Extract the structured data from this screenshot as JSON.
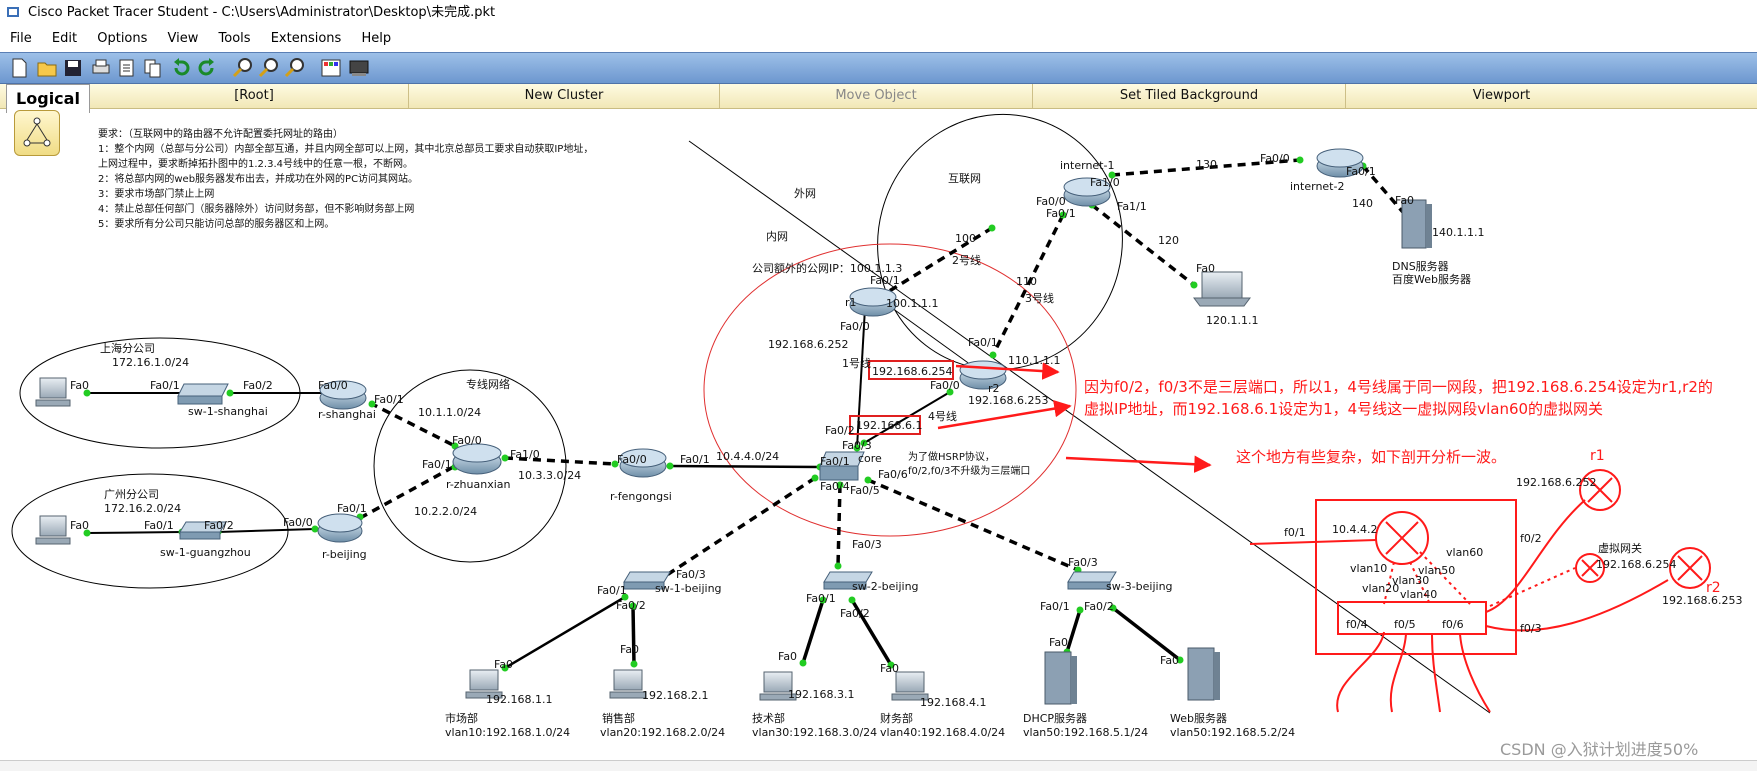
{
  "window": {
    "title": "Cisco Packet Tracer Student - C:\\Users\\Administrator\\Desktop\\未完成.pkt"
  },
  "menu": [
    "File",
    "Edit",
    "Options",
    "View",
    "Tools",
    "Extensions",
    "Help"
  ],
  "logical_bar": {
    "tab": "Logical",
    "root": "[Root]",
    "new_cluster": "New Cluster",
    "move_object": "Move Object",
    "set_background": "Set Tiled Background",
    "viewport": "Viewport"
  },
  "requirements": [
    "要求：（互联网中的路由器不允许配置委托网址的路由）",
    "1：整个内网（总部与分公司）内部全部互通，并且内网全部可以上网，其中北京总部员工要求自动获取IP地址，",
    "    上网过程中，要求断掉拓扑图中的1.2.3.4号线中的任意一根，不断网。",
    "2：将总部内网的web服务器发布出去，并成功在外网的PC访问其网站。",
    "3：要求市场部门禁止上网",
    "4：禁止总部任何部门（服务器除外）访问财务部，但不影响财务部上网",
    "5：要求所有分公司只能访问总部的服务器区和上网。"
  ],
  "zones": {
    "outer": "外网",
    "inner": "内网",
    "internet": "互联网",
    "dedicated": "专线网络",
    "public_ip": "公司额外的公网IP：100.1.1.3"
  },
  "devices": {
    "internet1": "internet-1",
    "internet2": "internet-2",
    "dns": "DNS服务器",
    "dns2": "百度Web服务器",
    "ip140": "140.1.1.1",
    "pc120": "120.1.1.1",
    "r1": "r1",
    "r2": "r2",
    "core": "core",
    "rshanghai": "r-shanghai",
    "rzhuanxian": "r-zhuanxian",
    "rbeijing": "r-beijing",
    "rfengongsi": "r-fengongsi",
    "swshanghai": "sw-1-shanghai",
    "swguangzhou": "sw-1-guangzhou",
    "sw1": "sw-1-beijing",
    "sw2": "sw-2-beijing",
    "sw3": "sw-3-beijing"
  },
  "branches": {
    "shanghai": "上海分公司",
    "shanghai_net": "172.16.1.0/24",
    "guangzhou": "广州分公司",
    "guangzhou_net": "172.16.2.0/24"
  },
  "links": {
    "l130": "130",
    "l140": "140",
    "l120": "120",
    "l100": "100",
    "l110": "110",
    "n2": "2号线",
    "n3": "3号线",
    "n1": "1号线",
    "n4": "4号线",
    "ip1001": "100.1.1.1",
    "ip1101": "110.1.1.1",
    "ip252": "192.168.6.252",
    "ip253": "192.168.6.253",
    "ip254": "192.168.6.254",
    "ip61": "192.168.6.1",
    "net1010": "10.1.1.0/24",
    "net1030": "10.3.3.0/24",
    "net1020": "10.2.2.0/24",
    "net1040": "10.4.4.0/24"
  },
  "hsrp_note": "为了做HSRP协议，\nf0/2,f0/3不升级为三层端口",
  "ports": {
    "fa0": "Fa0",
    "fa01": "Fa0/1",
    "fa02": "Fa0/2",
    "fa00": "Fa0/0",
    "fa10": "Fa1/0",
    "fa11": "Fa1/1",
    "fa03": "Fa0/3",
    "fa04": "Fa0/4",
    "fa05": "Fa0/5",
    "fa06": "Fa0/6"
  },
  "hosts": [
    {
      "ip": "192.168.1.1",
      "name": "市场部",
      "vlan": "vlan10:192.168.1.0/24"
    },
    {
      "ip": "192.168.2.1",
      "name": "销售部",
      "vlan": "vlan20:192.168.2.0/24"
    },
    {
      "ip": "192.168.3.1",
      "name": "技术部",
      "vlan": "vlan30:192.168.3.0/24"
    },
    {
      "ip": "192.168.4.1",
      "name": "财务部",
      "vlan": "vlan40:192.168.4.0/24"
    },
    {
      "name": "DHCP服务器",
      "vlan": "vlan50:192.168.5.1/24"
    },
    {
      "name": "Web服务器",
      "vlan": "vlan50:192.168.5.2/24"
    }
  ],
  "annotation": {
    "line1": "因为f0/2，f0/3不是三层端口，所以1，4号线属于同一网段，把192.168.6.254设定为r1,r2的",
    "line2": "虚拟IP地址，而192.168.6.1设定为1，4号线这一虚拟网段vlan60的虚拟网关",
    "complex": "这个地方有些复杂，如下剖开分析一波。"
  },
  "sketch": {
    "r1": "r1",
    "r2": "r2",
    "ip252": "192.168.6.252",
    "ip253": "192.168.6.253",
    "vgw": "虚拟网关",
    "vgw_ip": "192.168.6.254",
    "f01": "f0/1",
    "f02": "f0/2",
    "f03": "f0/3",
    "ip4442": "10.4.4.2",
    "vlan10": "vlan10",
    "vlan20": "vlan20",
    "vlan30": "vlan30",
    "vlan40": "vlan40",
    "vlan50": "vlan50",
    "vlan60": "vlan60",
    "f04": "f0/4",
    "f05": "f0/5",
    "f06": "f0/6"
  },
  "watermark": "CSDN @入狱计划进度50%",
  "colors": {
    "annotation": "#ff1a1a",
    "link": "#000000",
    "port_dot": "#22cc22",
    "toolbar": "#7ea6d9"
  }
}
